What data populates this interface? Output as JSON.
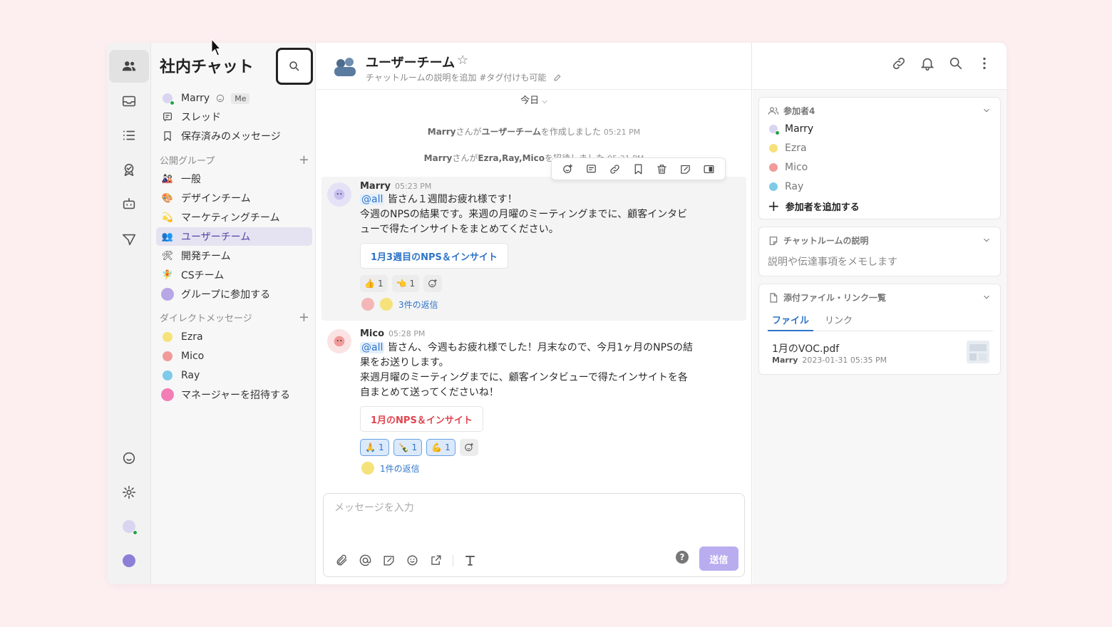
{
  "workspace": {
    "title": "社内チャット"
  },
  "sidebar": {
    "me": {
      "name": "Marry",
      "badge": "Me"
    },
    "threads_label": "スレッド",
    "saved_label": "保存済みのメッセージ",
    "public_groups": {
      "title": "公開グループ",
      "items": [
        {
          "label": "一般",
          "emoji": "🎎"
        },
        {
          "label": "デザインチーム",
          "emoji": "🎨"
        },
        {
          "label": "マーケティングチーム",
          "emoji": "💫"
        },
        {
          "label": "ユーザーチーム",
          "emoji": "👥",
          "active": true
        },
        {
          "label": "開発チーム",
          "emoji": "🛠"
        },
        {
          "label": "CSチーム",
          "emoji": "🧚"
        }
      ],
      "join_label": "グループに参加する"
    },
    "direct_messages": {
      "title": "ダイレクトメッセージ",
      "items": [
        {
          "label": "Ezra",
          "color": "#f5e27a"
        },
        {
          "label": "Mico",
          "color": "#f19a9a"
        },
        {
          "label": "Ray",
          "color": "#7ecbe8"
        }
      ],
      "invite_label": "マネージャーを招待する"
    }
  },
  "channel": {
    "title": "ユーザーチーム",
    "description": "チャットルームの説明を追加 #タグ付けも可能",
    "date_label": "今日"
  },
  "system_messages": [
    {
      "actor": "Marry",
      "text_a": "さんが",
      "target": "ユーザーチーム",
      "text_b": "を作成しました",
      "time": "05:21 PM"
    },
    {
      "actor": "Marry",
      "text_a": "さんが",
      "target": "Ezra,Ray,Mico",
      "text_b": "を招待しました",
      "time": "05:21 PM"
    }
  ],
  "messages": [
    {
      "author": "Marry",
      "time": "05:23 PM",
      "mention": "@all",
      "line1": " 皆さん１週間お疲れ様です！",
      "line2": "今週のNPSの結果です。来週の月曜のミーティングまでに、顧客インタビューで得たインサイトをまとめてください。",
      "card": "1月3週目のNPS＆インサイト",
      "card_color": "#2f74c8",
      "reactions": [
        {
          "emoji": "👍",
          "count": "1"
        },
        {
          "emoji": "👈",
          "count": "1"
        }
      ],
      "replies": "3件の返信"
    },
    {
      "author": "Mico",
      "time": "05:28 PM",
      "mention": "@all",
      "line1": " 皆さん、今週もお疲れ様でした！月末なので、今月1ヶ月のNPSの結果をお送りします。",
      "line2": "来週月曜のミーティングまでに、顧客インタビューで得たインサイトを各自まとめて送ってくださいね！",
      "card": "1月のNPS＆インサイト",
      "card_color": "#e0454f",
      "reactions": [
        {
          "emoji": "🙏",
          "count": "1"
        },
        {
          "emoji": "🍾",
          "count": "1"
        },
        {
          "emoji": "💪",
          "count": "1"
        }
      ],
      "replies": "1件の返信"
    }
  ],
  "composer": {
    "placeholder": "メッセージを入力",
    "send_label": "送信",
    "help": "?"
  },
  "right_panel": {
    "members": {
      "title": "参加者4",
      "items": [
        {
          "name": "Marry",
          "online": true
        },
        {
          "name": "Ezra",
          "online": false
        },
        {
          "name": "Mico",
          "online": false
        },
        {
          "name": "Ray",
          "online": false
        }
      ],
      "add_label": "参加者を追加する"
    },
    "description": {
      "title": "チャットルームの説明",
      "placeholder": "説明や伝達事項をメモします"
    },
    "files": {
      "title": "添付ファイル・リンク一覧",
      "tabs": [
        "ファイル",
        "リンク"
      ],
      "file_name": "1月のVOC.pdf",
      "file_author": "Marry",
      "file_date": "2023-01-31 05:35 PM"
    }
  },
  "colors": {
    "accent": "#5145a8",
    "link": "#2f74c8",
    "send": "#b9adf0"
  }
}
